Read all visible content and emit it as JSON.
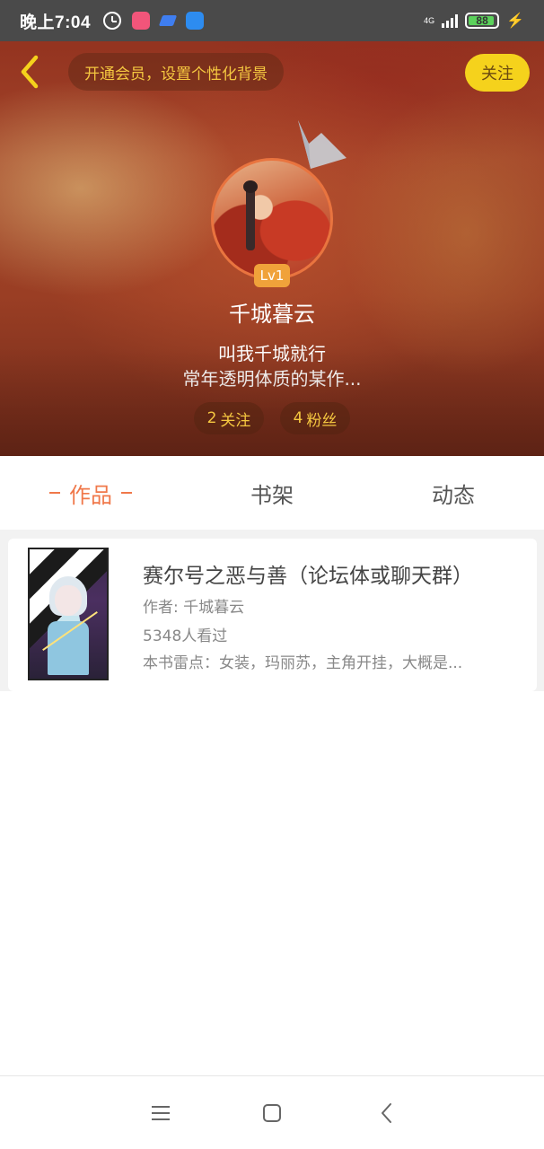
{
  "status_bar": {
    "time": "晚上7:04",
    "network_type": "4G",
    "battery_level": "88"
  },
  "header": {
    "vip_prompt": "开通会员，设置个性化背景",
    "follow_label": "关注",
    "level_badge": "Lv1",
    "username": "千城暮云",
    "bio_line1": "叫我千城就行",
    "bio_line2": "常年透明体质的某作...",
    "following_count": "2",
    "following_label": "关注",
    "fans_count": "4",
    "fans_label": "粉丝"
  },
  "tabs": [
    {
      "label": "作品",
      "active": true
    },
    {
      "label": "书架",
      "active": false
    },
    {
      "label": "动态",
      "active": false
    }
  ],
  "works": [
    {
      "title": "赛尔号之恶与善（论坛体或聊天群）",
      "author": "作者: 千城暮云",
      "views": "5348人看过",
      "description": "本书雷点：女装，玛丽苏，主角开挂，大概是..."
    }
  ],
  "colors": {
    "accent": "#f0784a",
    "follow_button": "#f5d21c",
    "level_badge": "#f0a23a",
    "gold_text": "#f5c740"
  }
}
